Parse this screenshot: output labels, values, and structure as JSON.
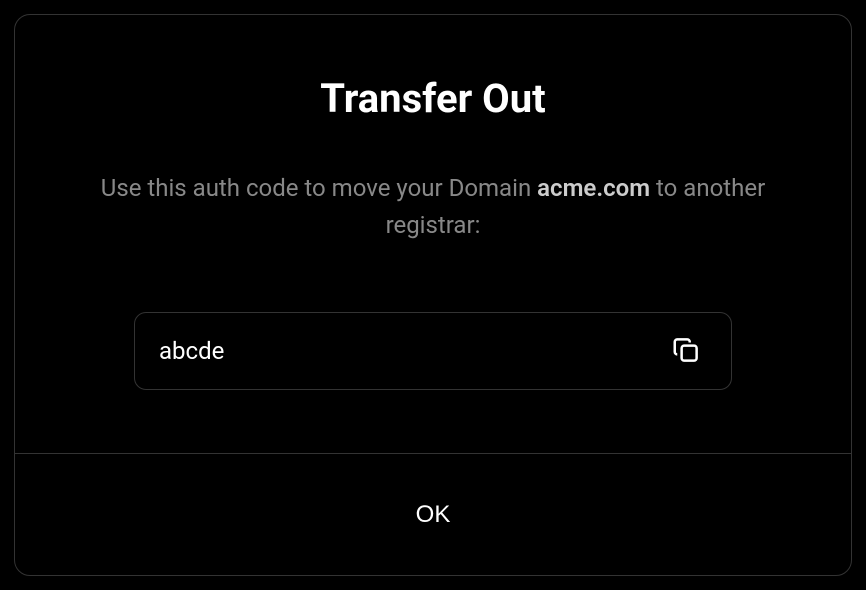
{
  "modal": {
    "title": "Transfer Out",
    "description_prefix": "Use this auth code to move your Domain ",
    "domain_name": "acme.com",
    "description_suffix": " to another registrar:",
    "auth_code": "abcde",
    "ok_label": "OK"
  }
}
